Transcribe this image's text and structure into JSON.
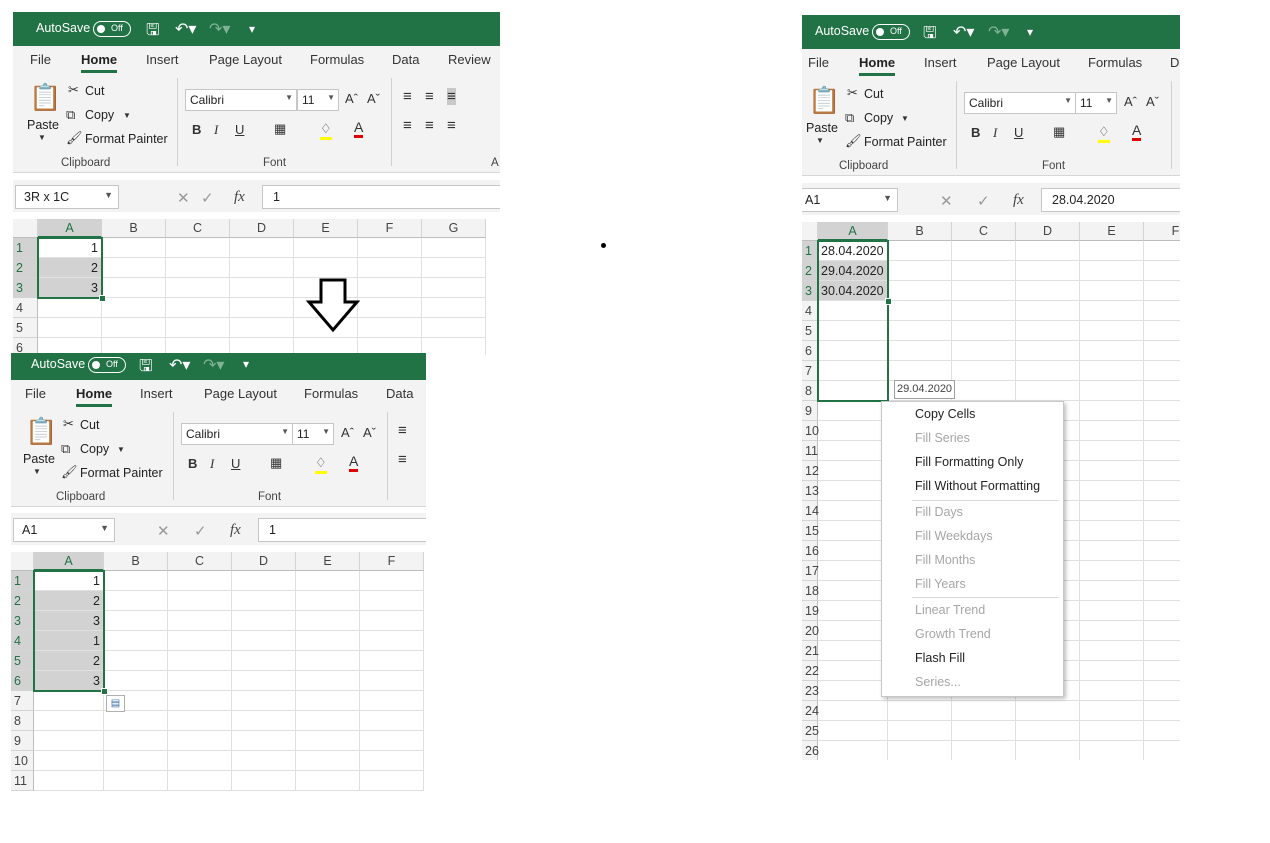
{
  "title_bar": {
    "autosave_label": "AutoSave",
    "toggle_state": "Off"
  },
  "tabs": [
    "File",
    "Home",
    "Insert",
    "Page Layout",
    "Formulas",
    "Data",
    "Review"
  ],
  "ribbon": {
    "paste": "Paste",
    "cut": "Cut",
    "copy": "Copy",
    "format_painter": "Format Painter",
    "clipboard_group": "Clipboard",
    "font_group": "Font",
    "font_name": "Calibri",
    "font_size": "11",
    "bold": "B",
    "italic": "I",
    "underline": "U",
    "alignment_group_partial": "A"
  },
  "formula_bar": {
    "fx_label": "fx"
  },
  "panel_top_left": {
    "name_box": "3R x 1C",
    "formula": "1",
    "columns": [
      "A",
      "B",
      "C",
      "D",
      "E",
      "F",
      "G"
    ],
    "rows": [
      "1",
      "2",
      "3",
      "4",
      "5",
      "6"
    ],
    "col_a_values": [
      "1",
      "2",
      "3"
    ]
  },
  "panel_bottom_left": {
    "name_box": "A1",
    "formula": "1",
    "columns": [
      "A",
      "B",
      "C",
      "D",
      "E",
      "F"
    ],
    "rows": [
      "1",
      "2",
      "3",
      "4",
      "5",
      "6",
      "7",
      "8",
      "9",
      "10",
      "11"
    ],
    "col_a_values": [
      "1",
      "2",
      "3",
      "1",
      "2",
      "3"
    ]
  },
  "panel_right": {
    "name_box": "A1",
    "formula": "28.04.2020",
    "columns": [
      "A",
      "B",
      "C",
      "D",
      "E",
      "F"
    ],
    "rows": [
      "1",
      "2",
      "3",
      "4",
      "5",
      "6",
      "7",
      "8",
      "9",
      "10",
      "11",
      "12",
      "13",
      "14",
      "15",
      "16",
      "17",
      "18",
      "19",
      "20",
      "21",
      "22",
      "23",
      "24",
      "25",
      "26"
    ],
    "col_a_values": [
      "28.04.2020",
      "29.04.2020",
      "30.04.2020"
    ],
    "fill_tooltip": "29.04.2020",
    "context_menu": [
      {
        "label": "Copy Cells",
        "enabled": true
      },
      {
        "label": "Fill Series",
        "enabled": false
      },
      {
        "label": "Fill Formatting Only",
        "enabled": true
      },
      {
        "label": "Fill Without Formatting",
        "enabled": true
      },
      {
        "label": "Fill Days",
        "enabled": false
      },
      {
        "label": "Fill Weekdays",
        "enabled": false
      },
      {
        "label": "Fill Months",
        "enabled": false
      },
      {
        "label": "Fill Years",
        "enabled": false
      },
      {
        "label": "Linear Trend",
        "enabled": false
      },
      {
        "label": "Growth Trend",
        "enabled": false
      },
      {
        "label": "Flash Fill",
        "enabled": true
      },
      {
        "label": "Series...",
        "enabled": false
      }
    ]
  },
  "colors": {
    "excel_green": "#217346",
    "selection_shade": "#d2d2d2",
    "ribbon_bg": "#f3f3f3"
  },
  "icons": [
    "undo-icon",
    "redo-icon",
    "save-icon",
    "customize-qat-icon",
    "down-arrow-icon",
    "paste-icon",
    "cut-icon",
    "copy-icon",
    "format-painter-icon",
    "quick-fill-options-icon"
  ]
}
